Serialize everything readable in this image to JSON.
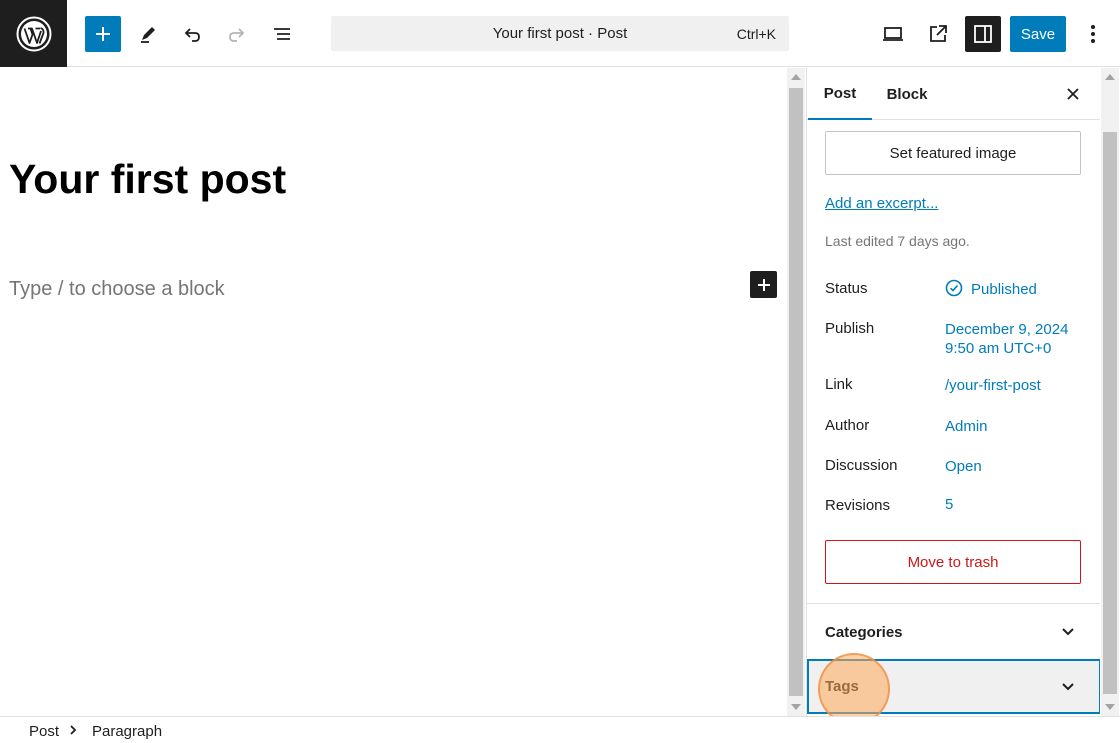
{
  "toolbar": {
    "document_title": "Your first post · Post",
    "shortcut": "Ctrl+K",
    "save_label": "Save"
  },
  "editor": {
    "post_title": "Your first post",
    "block_placeholder": "Type / to choose a block"
  },
  "sidebar": {
    "tabs": [
      {
        "label": "Post"
      },
      {
        "label": "Block"
      }
    ],
    "featured_image_label": "Set featured image",
    "excerpt_link": "Add an excerpt...",
    "last_edited": "Last edited 7 days ago.",
    "meta": {
      "status": {
        "label": "Status",
        "value": "Published"
      },
      "publish": {
        "label": "Publish",
        "date": "December 9, 2024",
        "time": "9:50 am UTC+0"
      },
      "link": {
        "label": "Link",
        "value": "/your-first-post"
      },
      "author": {
        "label": "Author",
        "value": "Admin"
      },
      "discussion": {
        "label": "Discussion",
        "value": "Open"
      },
      "revisions": {
        "label": "Revisions",
        "value": "5"
      }
    },
    "trash_label": "Move to trash",
    "panels": [
      {
        "label": "Categories"
      },
      {
        "label": "Tags"
      }
    ]
  },
  "breadcrumb": {
    "items": [
      "Post",
      "Paragraph"
    ]
  },
  "colors": {
    "accent": "#007cba",
    "danger": "#cc1818",
    "dark": "#1e1e1e"
  }
}
